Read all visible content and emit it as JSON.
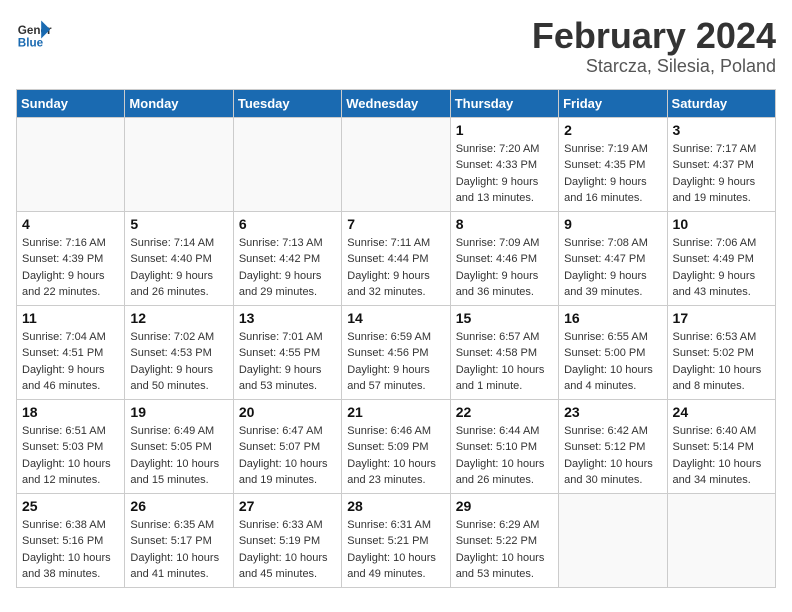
{
  "header": {
    "logo_line1": "General",
    "logo_line2": "Blue",
    "month_year": "February 2024",
    "location": "Starcza, Silesia, Poland"
  },
  "weekdays": [
    "Sunday",
    "Monday",
    "Tuesday",
    "Wednesday",
    "Thursday",
    "Friday",
    "Saturday"
  ],
  "weeks": [
    [
      {
        "day": "",
        "info": ""
      },
      {
        "day": "",
        "info": ""
      },
      {
        "day": "",
        "info": ""
      },
      {
        "day": "",
        "info": ""
      },
      {
        "day": "1",
        "info": "Sunrise: 7:20 AM\nSunset: 4:33 PM\nDaylight: 9 hours\nand 13 minutes."
      },
      {
        "day": "2",
        "info": "Sunrise: 7:19 AM\nSunset: 4:35 PM\nDaylight: 9 hours\nand 16 minutes."
      },
      {
        "day": "3",
        "info": "Sunrise: 7:17 AM\nSunset: 4:37 PM\nDaylight: 9 hours\nand 19 minutes."
      }
    ],
    [
      {
        "day": "4",
        "info": "Sunrise: 7:16 AM\nSunset: 4:39 PM\nDaylight: 9 hours\nand 22 minutes."
      },
      {
        "day": "5",
        "info": "Sunrise: 7:14 AM\nSunset: 4:40 PM\nDaylight: 9 hours\nand 26 minutes."
      },
      {
        "day": "6",
        "info": "Sunrise: 7:13 AM\nSunset: 4:42 PM\nDaylight: 9 hours\nand 29 minutes."
      },
      {
        "day": "7",
        "info": "Sunrise: 7:11 AM\nSunset: 4:44 PM\nDaylight: 9 hours\nand 32 minutes."
      },
      {
        "day": "8",
        "info": "Sunrise: 7:09 AM\nSunset: 4:46 PM\nDaylight: 9 hours\nand 36 minutes."
      },
      {
        "day": "9",
        "info": "Sunrise: 7:08 AM\nSunset: 4:47 PM\nDaylight: 9 hours\nand 39 minutes."
      },
      {
        "day": "10",
        "info": "Sunrise: 7:06 AM\nSunset: 4:49 PM\nDaylight: 9 hours\nand 43 minutes."
      }
    ],
    [
      {
        "day": "11",
        "info": "Sunrise: 7:04 AM\nSunset: 4:51 PM\nDaylight: 9 hours\nand 46 minutes."
      },
      {
        "day": "12",
        "info": "Sunrise: 7:02 AM\nSunset: 4:53 PM\nDaylight: 9 hours\nand 50 minutes."
      },
      {
        "day": "13",
        "info": "Sunrise: 7:01 AM\nSunset: 4:55 PM\nDaylight: 9 hours\nand 53 minutes."
      },
      {
        "day": "14",
        "info": "Sunrise: 6:59 AM\nSunset: 4:56 PM\nDaylight: 9 hours\nand 57 minutes."
      },
      {
        "day": "15",
        "info": "Sunrise: 6:57 AM\nSunset: 4:58 PM\nDaylight: 10 hours\nand 1 minute."
      },
      {
        "day": "16",
        "info": "Sunrise: 6:55 AM\nSunset: 5:00 PM\nDaylight: 10 hours\nand 4 minutes."
      },
      {
        "day": "17",
        "info": "Sunrise: 6:53 AM\nSunset: 5:02 PM\nDaylight: 10 hours\nand 8 minutes."
      }
    ],
    [
      {
        "day": "18",
        "info": "Sunrise: 6:51 AM\nSunset: 5:03 PM\nDaylight: 10 hours\nand 12 minutes."
      },
      {
        "day": "19",
        "info": "Sunrise: 6:49 AM\nSunset: 5:05 PM\nDaylight: 10 hours\nand 15 minutes."
      },
      {
        "day": "20",
        "info": "Sunrise: 6:47 AM\nSunset: 5:07 PM\nDaylight: 10 hours\nand 19 minutes."
      },
      {
        "day": "21",
        "info": "Sunrise: 6:46 AM\nSunset: 5:09 PM\nDaylight: 10 hours\nand 23 minutes."
      },
      {
        "day": "22",
        "info": "Sunrise: 6:44 AM\nSunset: 5:10 PM\nDaylight: 10 hours\nand 26 minutes."
      },
      {
        "day": "23",
        "info": "Sunrise: 6:42 AM\nSunset: 5:12 PM\nDaylight: 10 hours\nand 30 minutes."
      },
      {
        "day": "24",
        "info": "Sunrise: 6:40 AM\nSunset: 5:14 PM\nDaylight: 10 hours\nand 34 minutes."
      }
    ],
    [
      {
        "day": "25",
        "info": "Sunrise: 6:38 AM\nSunset: 5:16 PM\nDaylight: 10 hours\nand 38 minutes."
      },
      {
        "day": "26",
        "info": "Sunrise: 6:35 AM\nSunset: 5:17 PM\nDaylight: 10 hours\nand 41 minutes."
      },
      {
        "day": "27",
        "info": "Sunrise: 6:33 AM\nSunset: 5:19 PM\nDaylight: 10 hours\nand 45 minutes."
      },
      {
        "day": "28",
        "info": "Sunrise: 6:31 AM\nSunset: 5:21 PM\nDaylight: 10 hours\nand 49 minutes."
      },
      {
        "day": "29",
        "info": "Sunrise: 6:29 AM\nSunset: 5:22 PM\nDaylight: 10 hours\nand 53 minutes."
      },
      {
        "day": "",
        "info": ""
      },
      {
        "day": "",
        "info": ""
      }
    ]
  ]
}
